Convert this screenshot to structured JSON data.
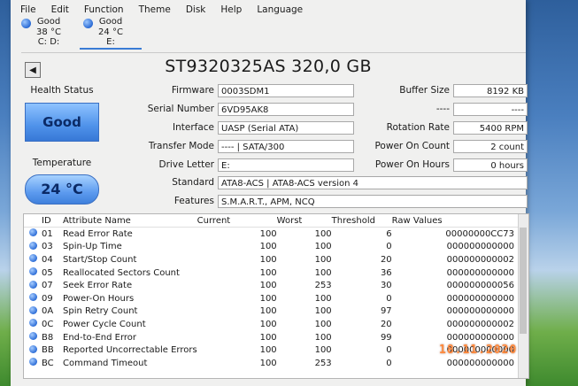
{
  "menu": [
    "File",
    "Edit",
    "Function",
    "Theme",
    "Disk",
    "Help",
    "Language"
  ],
  "drives": [
    {
      "status": "Good",
      "temp": "38 °C",
      "letter": "C: D:"
    },
    {
      "status": "Good",
      "temp": "24 °C",
      "letter": "E:"
    }
  ],
  "disk_title": "ST9320325AS 320,0 GB",
  "health": {
    "label": "Health Status",
    "value": "Good"
  },
  "temperature": {
    "label": "Temperature",
    "value": "24 °C"
  },
  "info": {
    "firmware": {
      "label": "Firmware",
      "value": "0003SDM1"
    },
    "serial": {
      "label": "Serial Number",
      "value": "6VD95AK8"
    },
    "interface": {
      "label": "Interface",
      "value": "UASP (Serial ATA)"
    },
    "transfer": {
      "label": "Transfer Mode",
      "value": "---- | SATA/300"
    },
    "drive_letter": {
      "label": "Drive Letter",
      "value": "E:"
    },
    "standard": {
      "label": "Standard",
      "value": "ATA8-ACS | ATA8-ACS version 4"
    },
    "features": {
      "label": "Features",
      "value": "S.M.A.R.T., APM, NCQ"
    },
    "buffer": {
      "label": "Buffer Size",
      "value": "8192 KB"
    },
    "blank": {
      "label": "----",
      "value": "----"
    },
    "rotation": {
      "label": "Rotation Rate",
      "value": "5400 RPM"
    },
    "power_count": {
      "label": "Power On Count",
      "value": "2 count"
    },
    "power_hours": {
      "label": "Power On Hours",
      "value": "0 hours"
    }
  },
  "smart": {
    "headers": {
      "id": "ID",
      "name": "Attribute Name",
      "current": "Current",
      "worst": "Worst",
      "threshold": "Threshold",
      "raw": "Raw Values"
    },
    "rows": [
      {
        "id": "01",
        "name": "Read Error Rate",
        "current": "100",
        "worst": "100",
        "threshold": "6",
        "raw": "00000000CC73"
      },
      {
        "id": "03",
        "name": "Spin-Up Time",
        "current": "100",
        "worst": "100",
        "threshold": "0",
        "raw": "000000000000"
      },
      {
        "id": "04",
        "name": "Start/Stop Count",
        "current": "100",
        "worst": "100",
        "threshold": "20",
        "raw": "000000000002"
      },
      {
        "id": "05",
        "name": "Reallocated Sectors Count",
        "current": "100",
        "worst": "100",
        "threshold": "36",
        "raw": "000000000000"
      },
      {
        "id": "07",
        "name": "Seek Error Rate",
        "current": "100",
        "worst": "253",
        "threshold": "30",
        "raw": "000000000056"
      },
      {
        "id": "09",
        "name": "Power-On Hours",
        "current": "100",
        "worst": "100",
        "threshold": "0",
        "raw": "000000000000"
      },
      {
        "id": "0A",
        "name": "Spin Retry Count",
        "current": "100",
        "worst": "100",
        "threshold": "97",
        "raw": "000000000000"
      },
      {
        "id": "0C",
        "name": "Power Cycle Count",
        "current": "100",
        "worst": "100",
        "threshold": "20",
        "raw": "000000000002"
      },
      {
        "id": "B8",
        "name": "End-to-End Error",
        "current": "100",
        "worst": "100",
        "threshold": "99",
        "raw": "000000000000"
      },
      {
        "id": "BB",
        "name": "Reported Uncorrectable Errors",
        "current": "100",
        "worst": "100",
        "threshold": "0",
        "raw": "000000000000"
      },
      {
        "id": "BC",
        "name": "Command Timeout",
        "current": "100",
        "worst": "253",
        "threshold": "0",
        "raw": "000000000000"
      }
    ]
  },
  "photo_date_stamp": "18.11.2020"
}
